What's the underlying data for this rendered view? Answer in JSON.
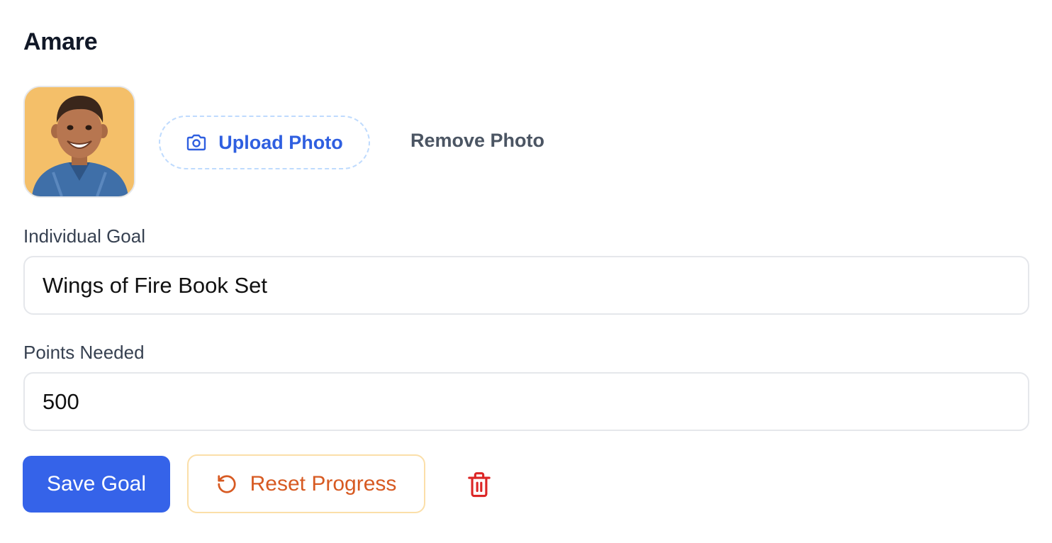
{
  "child": {
    "name": "Amare"
  },
  "photo": {
    "upload_label": "Upload Photo",
    "remove_label": "Remove Photo"
  },
  "goal": {
    "label": "Individual Goal",
    "value": "Wings of Fire Book Set"
  },
  "points": {
    "label": "Points Needed",
    "value": "500"
  },
  "actions": {
    "save_label": "Save Goal",
    "reset_label": "Reset Progress"
  },
  "icons": {
    "upload": "camera-icon",
    "reset": "rotate-ccw-icon",
    "delete": "trash-icon"
  },
  "colors": {
    "primary": "#3563e9",
    "upload_text": "#2f5fe0",
    "reset_text": "#d75a22",
    "reset_border": "#fbdfa9",
    "delete": "#dc2626",
    "avatar_bg": "#f4bf69"
  }
}
